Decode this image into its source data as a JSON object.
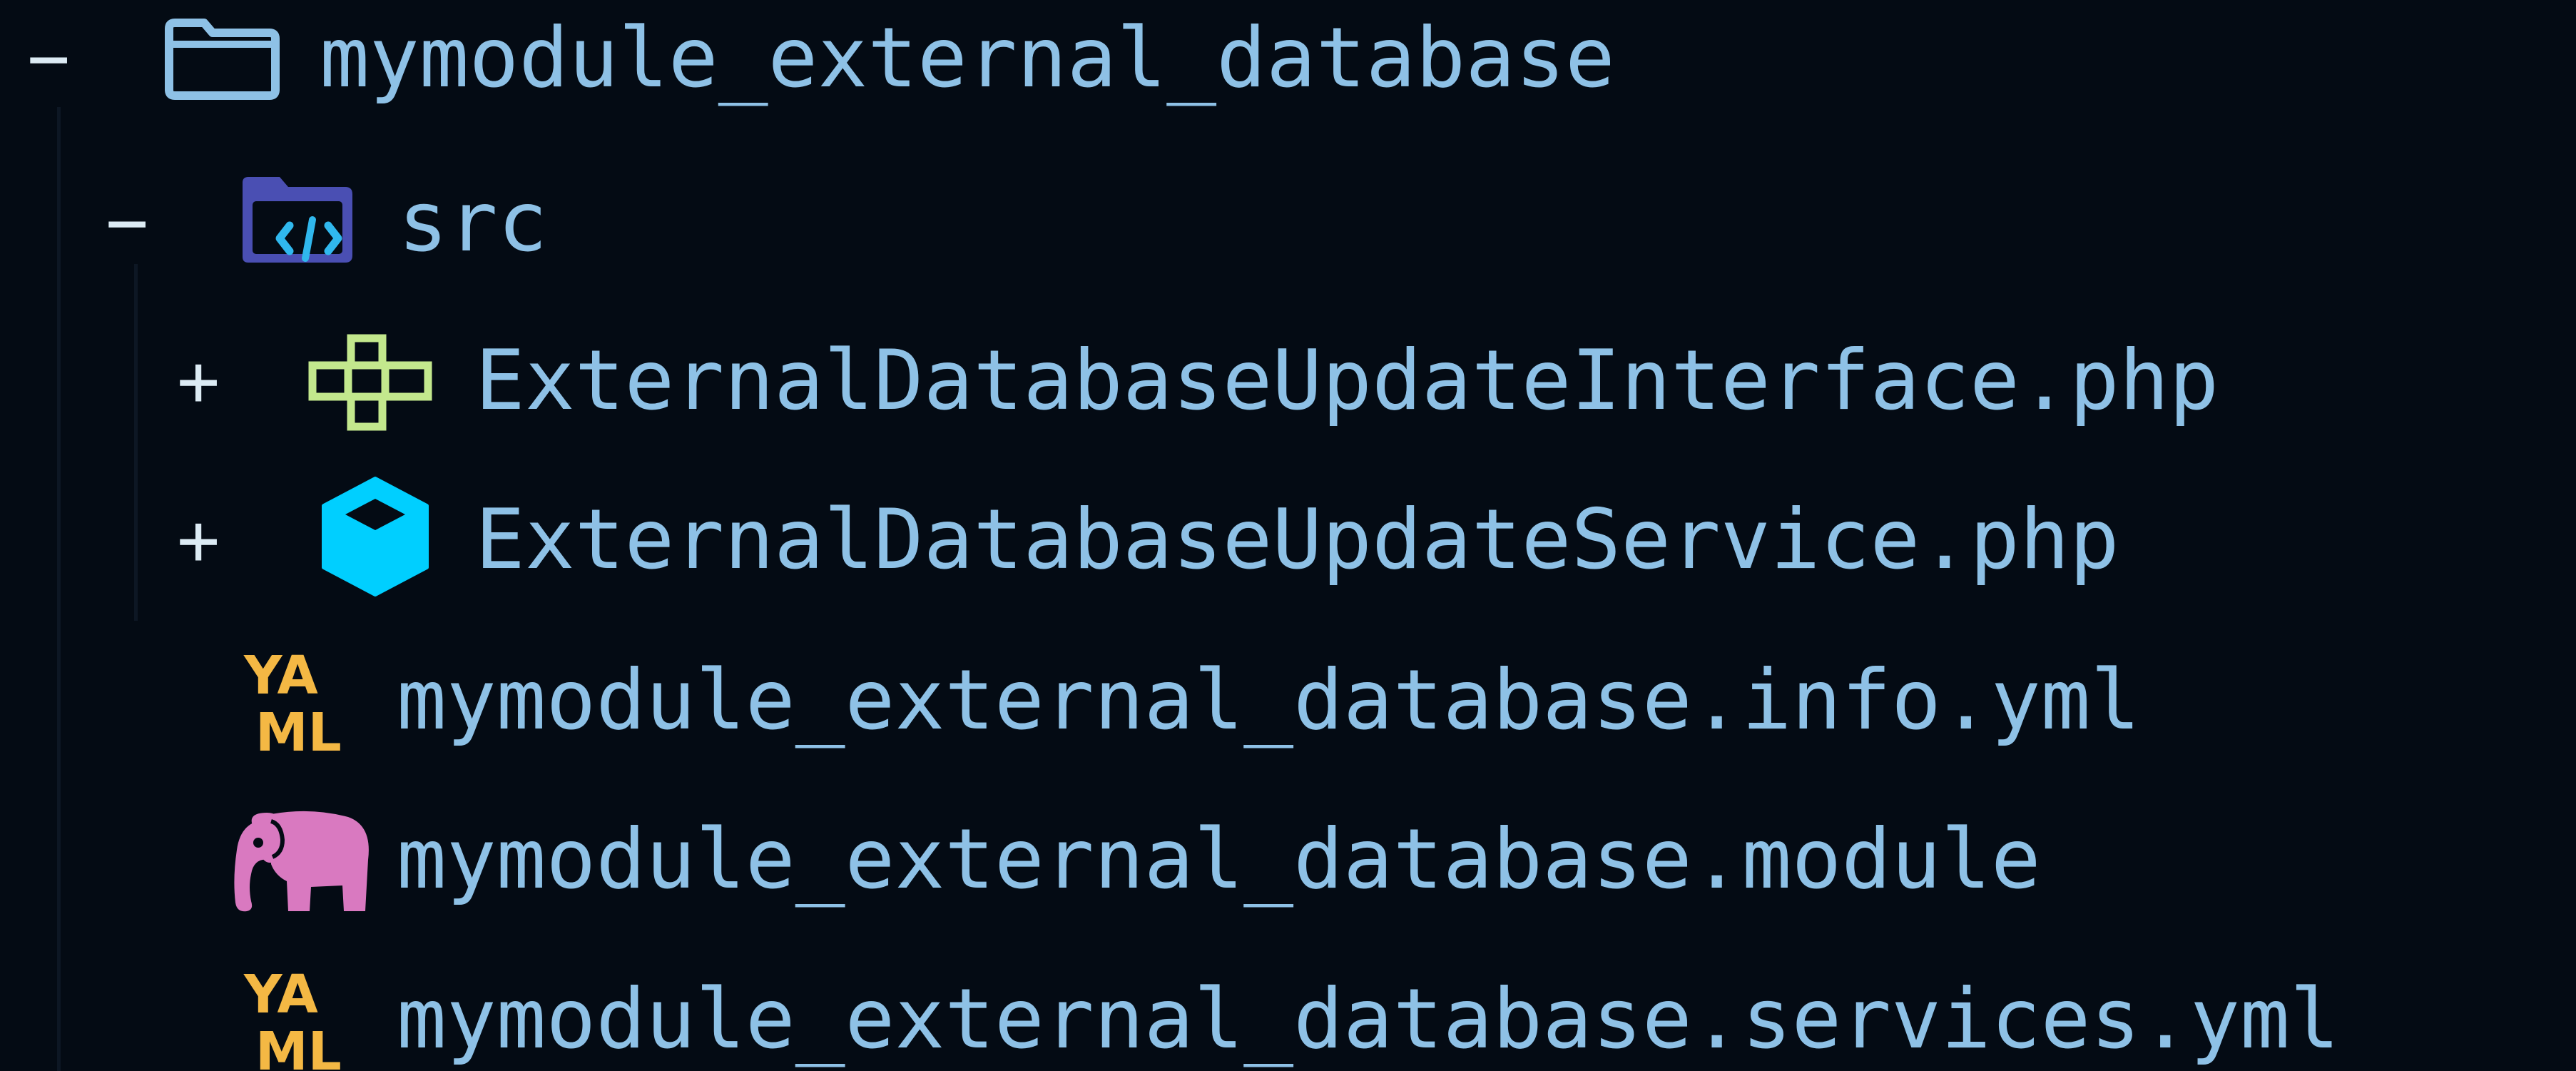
{
  "colors": {
    "background": "#040b14",
    "text": "#8ec1e6",
    "toggle": "#dcebf4"
  },
  "tree": {
    "root": {
      "toggle": "−",
      "icon": "folder-open-icon",
      "label": "mymodule_external_database"
    },
    "src": {
      "toggle": "−",
      "icon": "src-folder-icon",
      "label": "src"
    },
    "src_children": [
      {
        "toggle": "+",
        "icon": "interface-icon",
        "label": "ExternalDatabaseUpdateInterface.php"
      },
      {
        "toggle": "+",
        "icon": "class-cube-icon",
        "label": "ExternalDatabaseUpdateService.php"
      }
    ],
    "files": [
      {
        "icon": "yaml-file-icon",
        "icon_text_top": "YA",
        "icon_text_bottom": "ML",
        "label": "mymodule_external_database.info.yml"
      },
      {
        "icon": "php-elephant-icon",
        "label": "mymodule_external_database.module"
      },
      {
        "icon": "yaml-file-icon",
        "icon_text_top": "YA",
        "icon_text_bottom": "ML",
        "label": "mymodule_external_database.services.yml"
      }
    ]
  }
}
